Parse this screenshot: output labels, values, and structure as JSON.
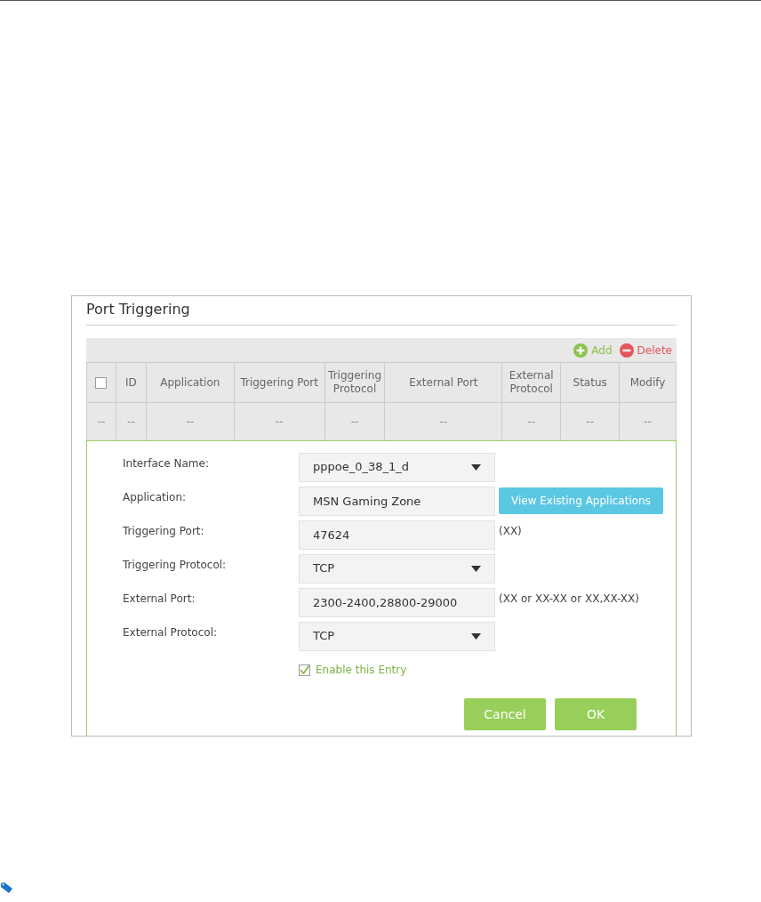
{
  "panel": {
    "title": "Port Triggering"
  },
  "toolbar": [
    {
      "kind": "add",
      "label": "Add"
    },
    {
      "kind": "delete",
      "label": "Delete"
    }
  ],
  "table": {
    "select_all": {
      "checked": false
    },
    "columns": [
      "",
      "ID",
      "Application",
      "Triggering Port",
      "Triggering Protocol",
      "External Port",
      "External Protocol",
      "Status",
      "Modify"
    ],
    "rows": [
      [
        "--",
        "--",
        "--",
        "--",
        "--",
        "--",
        "--",
        "--",
        "--"
      ]
    ]
  },
  "form": {
    "fields": [
      {
        "kind": "select",
        "label": "Interface Name:",
        "value": "pppoe_0_38_1_d"
      },
      {
        "kind": "input",
        "label": "Application:",
        "value": "MSN Gaming Zone",
        "action": "View Existing Applications"
      },
      {
        "kind": "input",
        "label": "Triggering Port:",
        "value": "47624",
        "hint": "(XX)"
      },
      {
        "kind": "select",
        "label": "Triggering Protocol:",
        "value": "TCP"
      },
      {
        "kind": "input",
        "label": "External Port:",
        "value": "2300-2400,28800-29000",
        "hint": "(XX or XX-XX or XX,XX-XX)"
      },
      {
        "kind": "select",
        "label": "External Protocol:",
        "value": "TCP"
      }
    ],
    "enable": {
      "label": "Enable this Entry",
      "checked": true
    },
    "buttons": [
      "Cancel",
      "OK"
    ]
  }
}
